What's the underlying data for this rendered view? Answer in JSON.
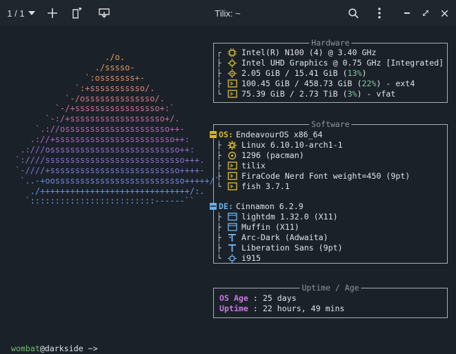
{
  "titlebar": {
    "session_counter": "1 / 1",
    "title": "Tilix: ~"
  },
  "colors": {
    "background": "#1b2129",
    "titlebar": "#20262e",
    "icon_yellow": "#d3b733",
    "icon_blue": "#6aaee8",
    "label_purple": "#c678dd",
    "percent_green": "#7ec699",
    "percent_yellow": "#e5c07b",
    "prompt_green": "#6cc06c"
  },
  "ascii_art": [
    "                  ./o.",
    "                ./sssso-",
    "              `:osssssss+-",
    "            `:+sssssssssso/.",
    "          `-/ossssssssssssso/.",
    "        `-/+sssssssssssssssso+:`",
    "      `-:/+sssssssssssssssssso+/.",
    "    `.://osssssssssssssssssssso++-",
    "   .://+ssssssssssssssssssssssso++:",
    " .:///ossssssssssssssssssssssssso++:",
    "`:////ssssssssssssssssssssssssssso+++.",
    "`-////+ssssssssssssssssssssssssso++++-",
    " `..-+oossssssssssssssssssssssssso+++++/`",
    "   ./++++++++++++++++++++++++++++++/:.",
    "  `:::::::::::::::::::::::::------``"
  ],
  "hardware": {
    "title": "Hardware",
    "cpu": "Intel(R) N100 (4) @ 3.40 GHz",
    "gpu": "Intel UHD Graphics @ 0.75 GHz [Integrated]",
    "memory_prefix": "2.05 GiB / 15.41 GiB (",
    "memory_pct": "13%",
    "memory_suffix": ")",
    "disk1_prefix": "100.45 GiB / 458.73 GiB (",
    "disk1_pct": "22%",
    "disk1_suffix": ") - ext4",
    "disk2_prefix": "75.39 GiB / 2.73 TiB (",
    "disk2_pct": "3%",
    "disk2_suffix": ") - vfat"
  },
  "software": {
    "title": "Software",
    "os_label": "OS:",
    "os": "EndeavourOS x86_64",
    "kernel": "Linux 6.10.10-arch1-1",
    "packages": "1296 (pacman)",
    "terminal": "tilix",
    "font": "FiraCode Nerd Font weight=450 (9pt)",
    "shell": "fish 3.7.1",
    "de_label": "DE:",
    "de": "Cinnamon 6.2.9",
    "lm": "lightdm 1.32.0 (X11)",
    "wm": "Muffin (X11)",
    "theme": "Arc-Dark (Adwaita)",
    "wm_font": "Liberation Sans (9pt)",
    "gpu_driver": "i915"
  },
  "uptime": {
    "title": "Uptime / Age",
    "os_age_label": "OS Age",
    "os_age_value": " : 25 days",
    "uptime_label": "Uptime",
    "uptime_value": " : 22 hours, 49 mins"
  },
  "prompt": {
    "user": "wombat",
    "at_host": "@darkside",
    "path": " ~>"
  }
}
